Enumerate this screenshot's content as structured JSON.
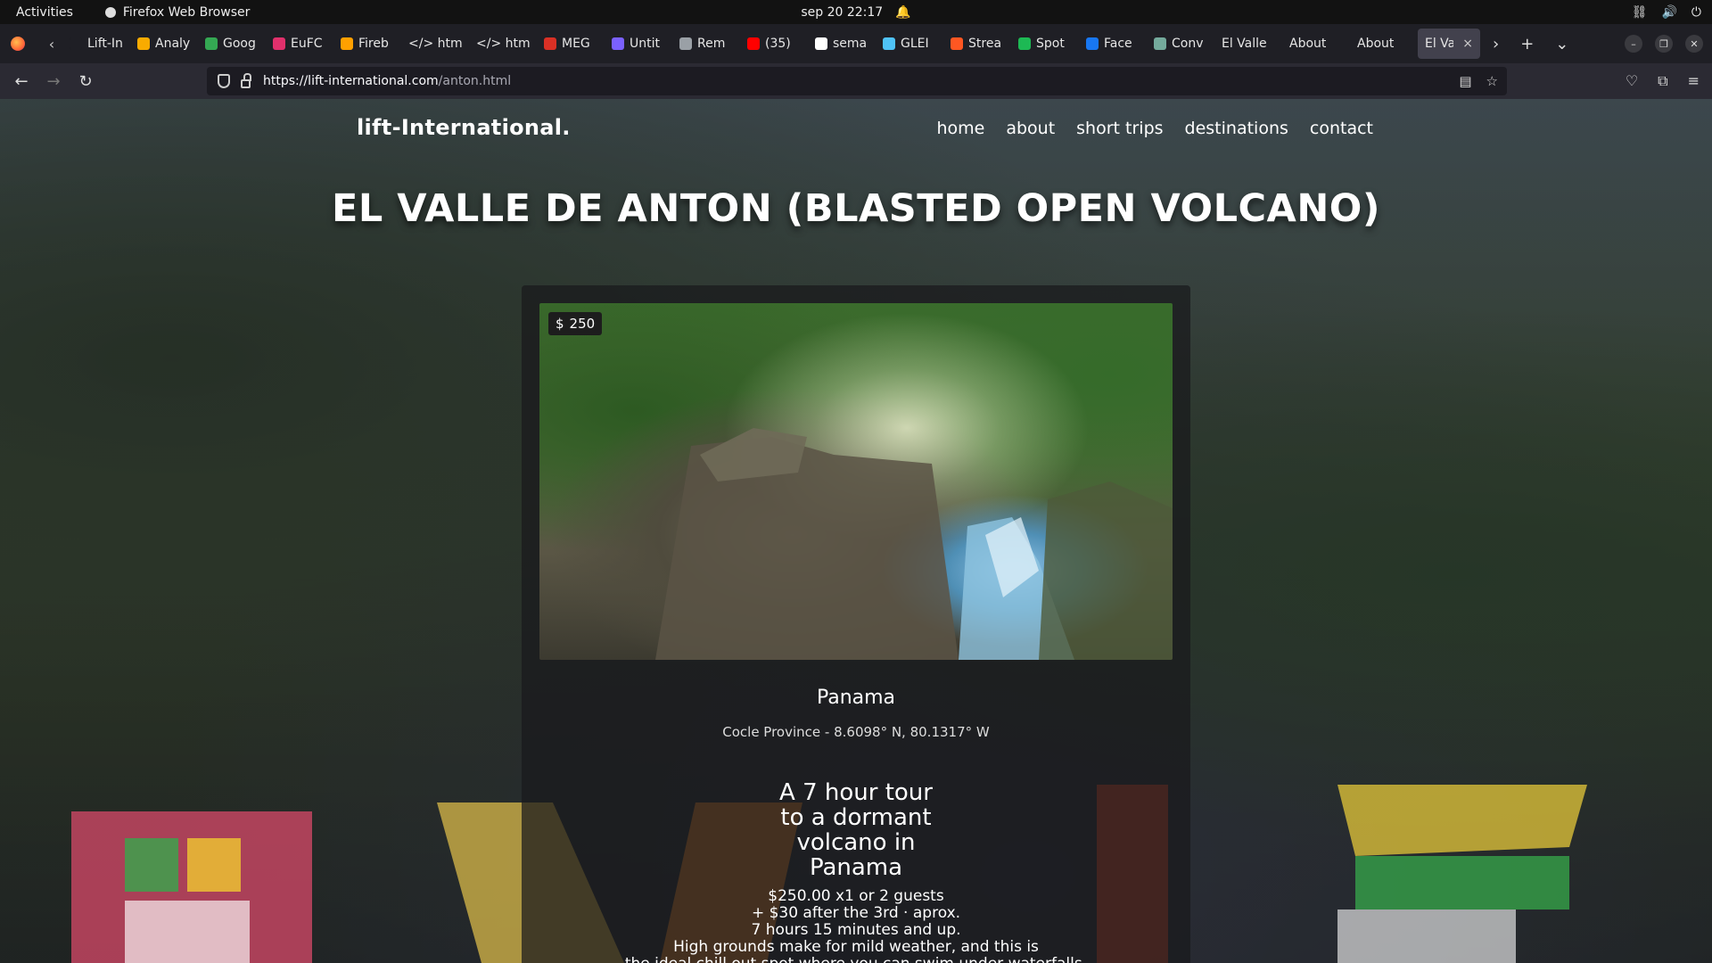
{
  "system": {
    "activities": "Activities",
    "app_name": "Firefox Web Browser",
    "datetime": "sep 20  22:17"
  },
  "tabs": [
    {
      "label": "Lift-Intl-",
      "color": "#1f1f25"
    },
    {
      "label": "Analy",
      "color": "#f9ab00"
    },
    {
      "label": "Goog",
      "color": "#34a853"
    },
    {
      "label": "EuFC",
      "color": "#e1306c"
    },
    {
      "label": "Fireb",
      "color": "#ffa000"
    },
    {
      "label": "</> htm",
      "color": ""
    },
    {
      "label": "</> htm",
      "color": ""
    },
    {
      "label": "MEG",
      "color": "#d93025"
    },
    {
      "label": "Untit",
      "color": "#7b61ff"
    },
    {
      "label": "Rem",
      "color": "#9aa0a6"
    },
    {
      "label": "(35)",
      "color": "#ff0000"
    },
    {
      "label": "sema",
      "color": "#ffffff"
    },
    {
      "label": "GLEI",
      "color": "#4fc3f7"
    },
    {
      "label": "Strea",
      "color": "#ff5722"
    },
    {
      "label": "Spot",
      "color": "#1db954"
    },
    {
      "label": "Face",
      "color": "#1877f2"
    },
    {
      "label": "Conv",
      "color": "#74aa9c"
    },
    {
      "label": "El Valle",
      "color": ""
    },
    {
      "label": "About",
      "color": ""
    },
    {
      "label": "About",
      "color": ""
    }
  ],
  "active_tab": {
    "label": "El Vall",
    "close": "×"
  },
  "browser": {
    "url_host": "https://lift-international.com",
    "url_path": "/anton.html"
  },
  "site": {
    "logo": "lift-International.",
    "nav": [
      "home",
      "about",
      "short trips",
      "destinations",
      "contact"
    ],
    "title": "EL VALLE DE ANTON (BLASTED OPEN VOLCANO)"
  },
  "card": {
    "price_symbol": "$",
    "price": "250",
    "country": "Panama",
    "coords": "Cocle Province - 8.6098° N, 80.1317° W",
    "desc_title": "A 7 hour tour to a dormant volcano in Panama",
    "desc_lines": [
      "$250.00 x1 or 2 guests",
      "+ $30 after the 3rd · aprox.",
      "7 hours 15 minutes and up.",
      "High grounds make for mild weather, and this is",
      "the ideal chill out spot where you can swim under waterfalls,"
    ]
  }
}
